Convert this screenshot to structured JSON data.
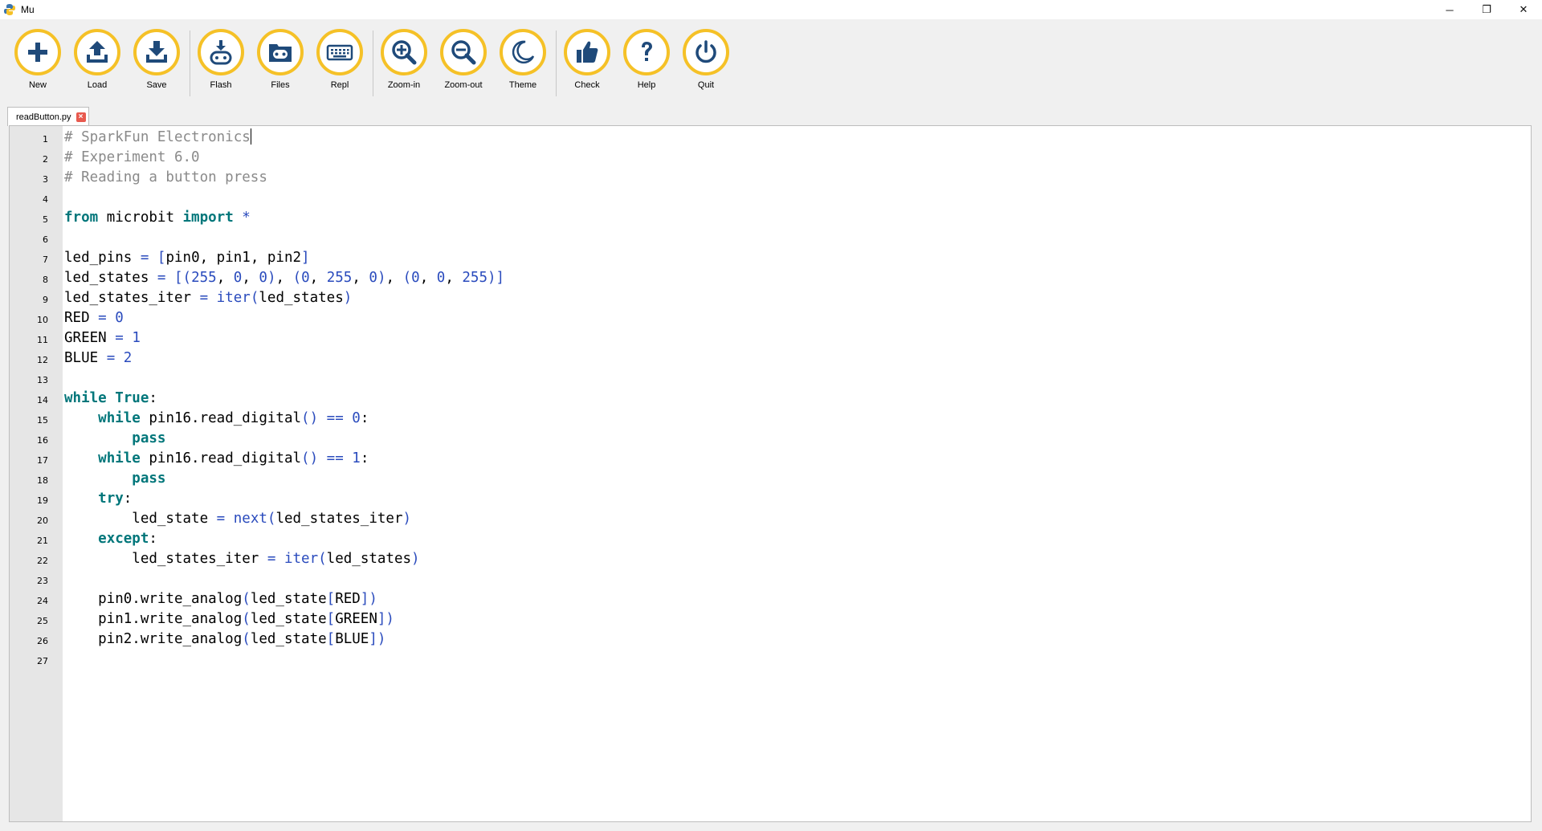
{
  "window": {
    "title": "Mu",
    "controls": {
      "minimize": "─",
      "restore": "❐",
      "close": "✕"
    }
  },
  "toolbar": {
    "accent": "#f5c127",
    "icon_color": "#1f4a7a",
    "buttons": [
      {
        "id": "new",
        "label": "New",
        "icon": "plus-icon"
      },
      {
        "id": "load",
        "label": "Load",
        "icon": "upload-icon"
      },
      {
        "id": "save",
        "label": "Save",
        "icon": "download-icon"
      },
      {
        "id": "flash",
        "label": "Flash",
        "icon": "flash-device-icon"
      },
      {
        "id": "files",
        "label": "Files",
        "icon": "files-device-icon"
      },
      {
        "id": "repl",
        "label": "Repl",
        "icon": "keyboard-icon"
      },
      {
        "id": "zoom-in",
        "label": "Zoom-in",
        "icon": "zoom-in-icon"
      },
      {
        "id": "zoom-out",
        "label": "Zoom-out",
        "icon": "zoom-out-icon"
      },
      {
        "id": "theme",
        "label": "Theme",
        "icon": "moon-icon"
      },
      {
        "id": "check",
        "label": "Check",
        "icon": "thumbs-up-icon"
      },
      {
        "id": "help",
        "label": "Help",
        "icon": "question-icon"
      },
      {
        "id": "quit",
        "label": "Quit",
        "icon": "power-icon"
      }
    ]
  },
  "tabs": [
    {
      "label": "readButton.py",
      "close_icon": "close-icon",
      "active": true
    }
  ],
  "editor": {
    "lines": [
      {
        "n": "1",
        "tokens": [
          [
            "comment",
            "# SparkFun Electronics"
          ]
        ],
        "caret": true
      },
      {
        "n": "2",
        "tokens": [
          [
            "comment",
            "# Experiment 6.0"
          ]
        ]
      },
      {
        "n": "3",
        "tokens": [
          [
            "comment",
            "# Reading a button press"
          ]
        ]
      },
      {
        "n": "4",
        "tokens": []
      },
      {
        "n": "5",
        "tokens": [
          [
            "keyword",
            "from"
          ],
          [
            "plain",
            " microbit "
          ],
          [
            "keyword",
            "import"
          ],
          [
            "plain",
            " "
          ],
          [
            "op",
            "*"
          ]
        ]
      },
      {
        "n": "6",
        "tokens": []
      },
      {
        "n": "7",
        "tokens": [
          [
            "plain",
            "led_pins "
          ],
          [
            "op",
            "="
          ],
          [
            "plain",
            " "
          ],
          [
            "op",
            "["
          ],
          [
            "plain",
            "pin0, pin1, pin2"
          ],
          [
            "op",
            "]"
          ]
        ]
      },
      {
        "n": "8",
        "tokens": [
          [
            "plain",
            "led_states "
          ],
          [
            "op",
            "="
          ],
          [
            "plain",
            " "
          ],
          [
            "op",
            "[("
          ],
          [
            "number",
            "255"
          ],
          [
            "plain",
            ", "
          ],
          [
            "number",
            "0"
          ],
          [
            "plain",
            ", "
          ],
          [
            "number",
            "0"
          ],
          [
            "op",
            ")"
          ],
          [
            "plain",
            ", "
          ],
          [
            "op",
            "("
          ],
          [
            "number",
            "0"
          ],
          [
            "plain",
            ", "
          ],
          [
            "number",
            "255"
          ],
          [
            "plain",
            ", "
          ],
          [
            "number",
            "0"
          ],
          [
            "op",
            ")"
          ],
          [
            "plain",
            ", "
          ],
          [
            "op",
            "("
          ],
          [
            "number",
            "0"
          ],
          [
            "plain",
            ", "
          ],
          [
            "number",
            "0"
          ],
          [
            "plain",
            ", "
          ],
          [
            "number",
            "255"
          ],
          [
            "op",
            ")]"
          ]
        ]
      },
      {
        "n": "9",
        "tokens": [
          [
            "plain",
            "led_states_iter "
          ],
          [
            "op",
            "="
          ],
          [
            "plain",
            " "
          ],
          [
            "builtin",
            "iter"
          ],
          [
            "op",
            "("
          ],
          [
            "plain",
            "led_states"
          ],
          [
            "op",
            ")"
          ]
        ]
      },
      {
        "n": "10",
        "tokens": [
          [
            "plain",
            "RED "
          ],
          [
            "op",
            "="
          ],
          [
            "plain",
            " "
          ],
          [
            "number",
            "0"
          ]
        ]
      },
      {
        "n": "11",
        "tokens": [
          [
            "plain",
            "GREEN "
          ],
          [
            "op",
            "="
          ],
          [
            "plain",
            " "
          ],
          [
            "number",
            "1"
          ]
        ]
      },
      {
        "n": "12",
        "tokens": [
          [
            "plain",
            "BLUE "
          ],
          [
            "op",
            "="
          ],
          [
            "plain",
            " "
          ],
          [
            "number",
            "2"
          ]
        ]
      },
      {
        "n": "13",
        "tokens": []
      },
      {
        "n": "14",
        "tokens": [
          [
            "keyword",
            "while"
          ],
          [
            "plain",
            " "
          ],
          [
            "keyword",
            "True"
          ],
          [
            "plain",
            ":"
          ]
        ]
      },
      {
        "n": "15",
        "tokens": [
          [
            "plain",
            "    "
          ],
          [
            "keyword",
            "while"
          ],
          [
            "plain",
            " pin16.read_digital"
          ],
          [
            "op",
            "()"
          ],
          [
            "plain",
            " "
          ],
          [
            "op",
            "=="
          ],
          [
            "plain",
            " "
          ],
          [
            "number",
            "0"
          ],
          [
            "plain",
            ":"
          ]
        ]
      },
      {
        "n": "16",
        "tokens": [
          [
            "plain",
            "        "
          ],
          [
            "keyword",
            "pass"
          ]
        ]
      },
      {
        "n": "17",
        "tokens": [
          [
            "plain",
            "    "
          ],
          [
            "keyword",
            "while"
          ],
          [
            "plain",
            " pin16.read_digital"
          ],
          [
            "op",
            "()"
          ],
          [
            "plain",
            " "
          ],
          [
            "op",
            "=="
          ],
          [
            "plain",
            " "
          ],
          [
            "number",
            "1"
          ],
          [
            "plain",
            ":"
          ]
        ]
      },
      {
        "n": "18",
        "tokens": [
          [
            "plain",
            "        "
          ],
          [
            "keyword",
            "pass"
          ]
        ]
      },
      {
        "n": "19",
        "tokens": [
          [
            "plain",
            "    "
          ],
          [
            "keyword",
            "try"
          ],
          [
            "plain",
            ":"
          ]
        ]
      },
      {
        "n": "20",
        "tokens": [
          [
            "plain",
            "        led_state "
          ],
          [
            "op",
            "="
          ],
          [
            "plain",
            " "
          ],
          [
            "builtin",
            "next"
          ],
          [
            "op",
            "("
          ],
          [
            "plain",
            "led_states_iter"
          ],
          [
            "op",
            ")"
          ]
        ]
      },
      {
        "n": "21",
        "tokens": [
          [
            "plain",
            "    "
          ],
          [
            "keyword",
            "except"
          ],
          [
            "plain",
            ":"
          ]
        ]
      },
      {
        "n": "22",
        "tokens": [
          [
            "plain",
            "        led_states_iter "
          ],
          [
            "op",
            "="
          ],
          [
            "plain",
            " "
          ],
          [
            "builtin",
            "iter"
          ],
          [
            "op",
            "("
          ],
          [
            "plain",
            "led_states"
          ],
          [
            "op",
            ")"
          ]
        ]
      },
      {
        "n": "23",
        "tokens": []
      },
      {
        "n": "24",
        "tokens": [
          [
            "plain",
            "    pin0.write_analog"
          ],
          [
            "op",
            "("
          ],
          [
            "plain",
            "led_state"
          ],
          [
            "op",
            "["
          ],
          [
            "plain",
            "RED"
          ],
          [
            "op",
            "])"
          ]
        ]
      },
      {
        "n": "25",
        "tokens": [
          [
            "plain",
            "    pin1.write_analog"
          ],
          [
            "op",
            "("
          ],
          [
            "plain",
            "led_state"
          ],
          [
            "op",
            "["
          ],
          [
            "plain",
            "GREEN"
          ],
          [
            "op",
            "])"
          ]
        ]
      },
      {
        "n": "26",
        "tokens": [
          [
            "plain",
            "    pin2.write_analog"
          ],
          [
            "op",
            "("
          ],
          [
            "plain",
            "led_state"
          ],
          [
            "op",
            "["
          ],
          [
            "plain",
            "BLUE"
          ],
          [
            "op",
            "])"
          ]
        ]
      },
      {
        "n": "27",
        "tokens": []
      }
    ]
  }
}
